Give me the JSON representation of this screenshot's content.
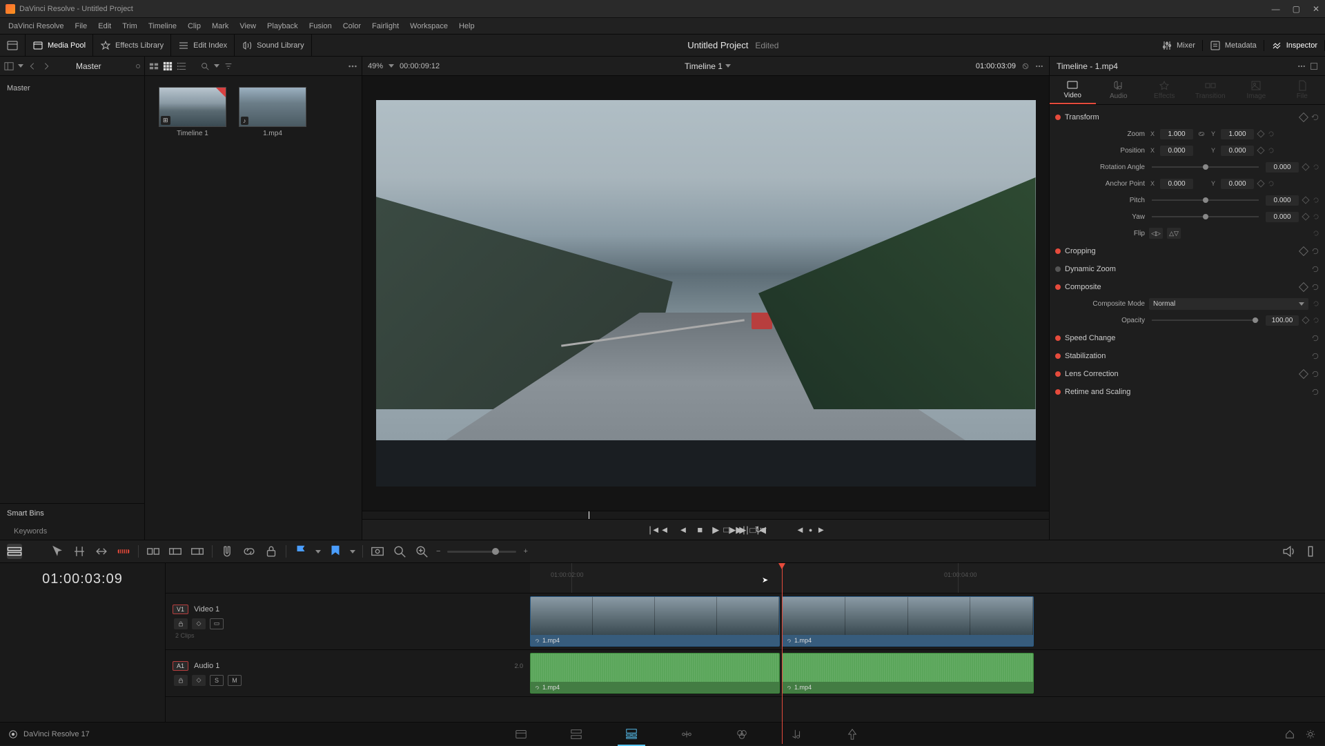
{
  "window": {
    "title": "DaVinci Resolve - Untitled Project"
  },
  "menu": [
    "DaVinci Resolve",
    "File",
    "Edit",
    "Trim",
    "Timeline",
    "Clip",
    "Mark",
    "View",
    "Playback",
    "Fusion",
    "Color",
    "Fairlight",
    "Workspace",
    "Help"
  ],
  "toolbar": {
    "media_pool": "Media Pool",
    "effects_library": "Effects Library",
    "edit_index": "Edit Index",
    "sound_library": "Sound Library",
    "mixer": "Mixer",
    "metadata": "Metadata",
    "inspector": "Inspector"
  },
  "project": {
    "title": "Untitled Project",
    "status": "Edited"
  },
  "media": {
    "bin_root": "Master",
    "master": "Master",
    "smart_bins": "Smart Bins",
    "keywords": "Keywords"
  },
  "clips": [
    {
      "name": "Timeline 1",
      "badge": "⊞"
    },
    {
      "name": "1.mp4",
      "badge": "♪"
    }
  ],
  "viewer": {
    "zoom": "49%",
    "tc_left": "00:00:09:12",
    "title": "Timeline 1",
    "tc_right": "01:00:03:09"
  },
  "inspector": {
    "title": "Timeline - 1.mp4",
    "tabs": [
      "Video",
      "Audio",
      "Effects",
      "Transition",
      "Image",
      "File"
    ],
    "transform": {
      "label": "Transform",
      "zoom_label": "Zoom",
      "zoom_x": "1.000",
      "zoom_y": "1.000",
      "position_label": "Position",
      "pos_x": "0.000",
      "pos_y": "0.000",
      "rotation_label": "Rotation Angle",
      "rotation": "0.000",
      "anchor_label": "Anchor Point",
      "anchor_x": "0.000",
      "anchor_y": "0.000",
      "pitch_label": "Pitch",
      "pitch": "0.000",
      "yaw_label": "Yaw",
      "yaw": "0.000",
      "flip_label": "Flip"
    },
    "cropping": "Cropping",
    "dynamic_zoom": "Dynamic Zoom",
    "composite": {
      "label": "Composite",
      "mode_label": "Composite Mode",
      "mode_value": "Normal",
      "opacity_label": "Opacity",
      "opacity": "100.00"
    },
    "speed_change": "Speed Change",
    "stabilization": "Stabilization",
    "lens_correction": "Lens Correction",
    "retime": "Retime and Scaling"
  },
  "timeline": {
    "tc": "01:00:03:09",
    "video_track": {
      "tag": "V1",
      "name": "Video 1",
      "sub": "2 Clips"
    },
    "audio_track": {
      "tag": "A1",
      "name": "Audio 1",
      "ch": "2.0"
    },
    "clip_name_1": "1.mp4",
    "clip_name_2": "1.mp4",
    "ruler_labels": [
      "01:00:02:00",
      "01:00:04:00"
    ]
  },
  "footer": {
    "version": "DaVinci Resolve 17"
  }
}
